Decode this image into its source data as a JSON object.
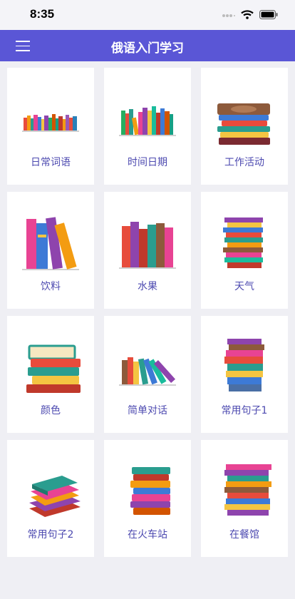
{
  "status": {
    "time": "8:35"
  },
  "nav": {
    "title": "俄语入门学习",
    "menu_icon": "hamburger-icon"
  },
  "accent_color": "#5a56d6",
  "categories": [
    {
      "label": "日常词语",
      "icon": "books-row-icon"
    },
    {
      "label": "时间日期",
      "icon": "books-row-icon"
    },
    {
      "label": "工作活动",
      "icon": "book-stack-icon"
    },
    {
      "label": "饮料",
      "icon": "books-leaning-icon"
    },
    {
      "label": "水果",
      "icon": "books-row-icon"
    },
    {
      "label": "天气",
      "icon": "book-stack-icon"
    },
    {
      "label": "颜色",
      "icon": "book-stack-icon"
    },
    {
      "label": "简单对话",
      "icon": "books-leaning-icon"
    },
    {
      "label": "常用句子1",
      "icon": "book-stack-icon"
    },
    {
      "label": "常用句子2",
      "icon": "book-stack-icon"
    },
    {
      "label": "在火车站",
      "icon": "book-stack-icon"
    },
    {
      "label": "在餐馆",
      "icon": "book-stack-icon"
    }
  ]
}
